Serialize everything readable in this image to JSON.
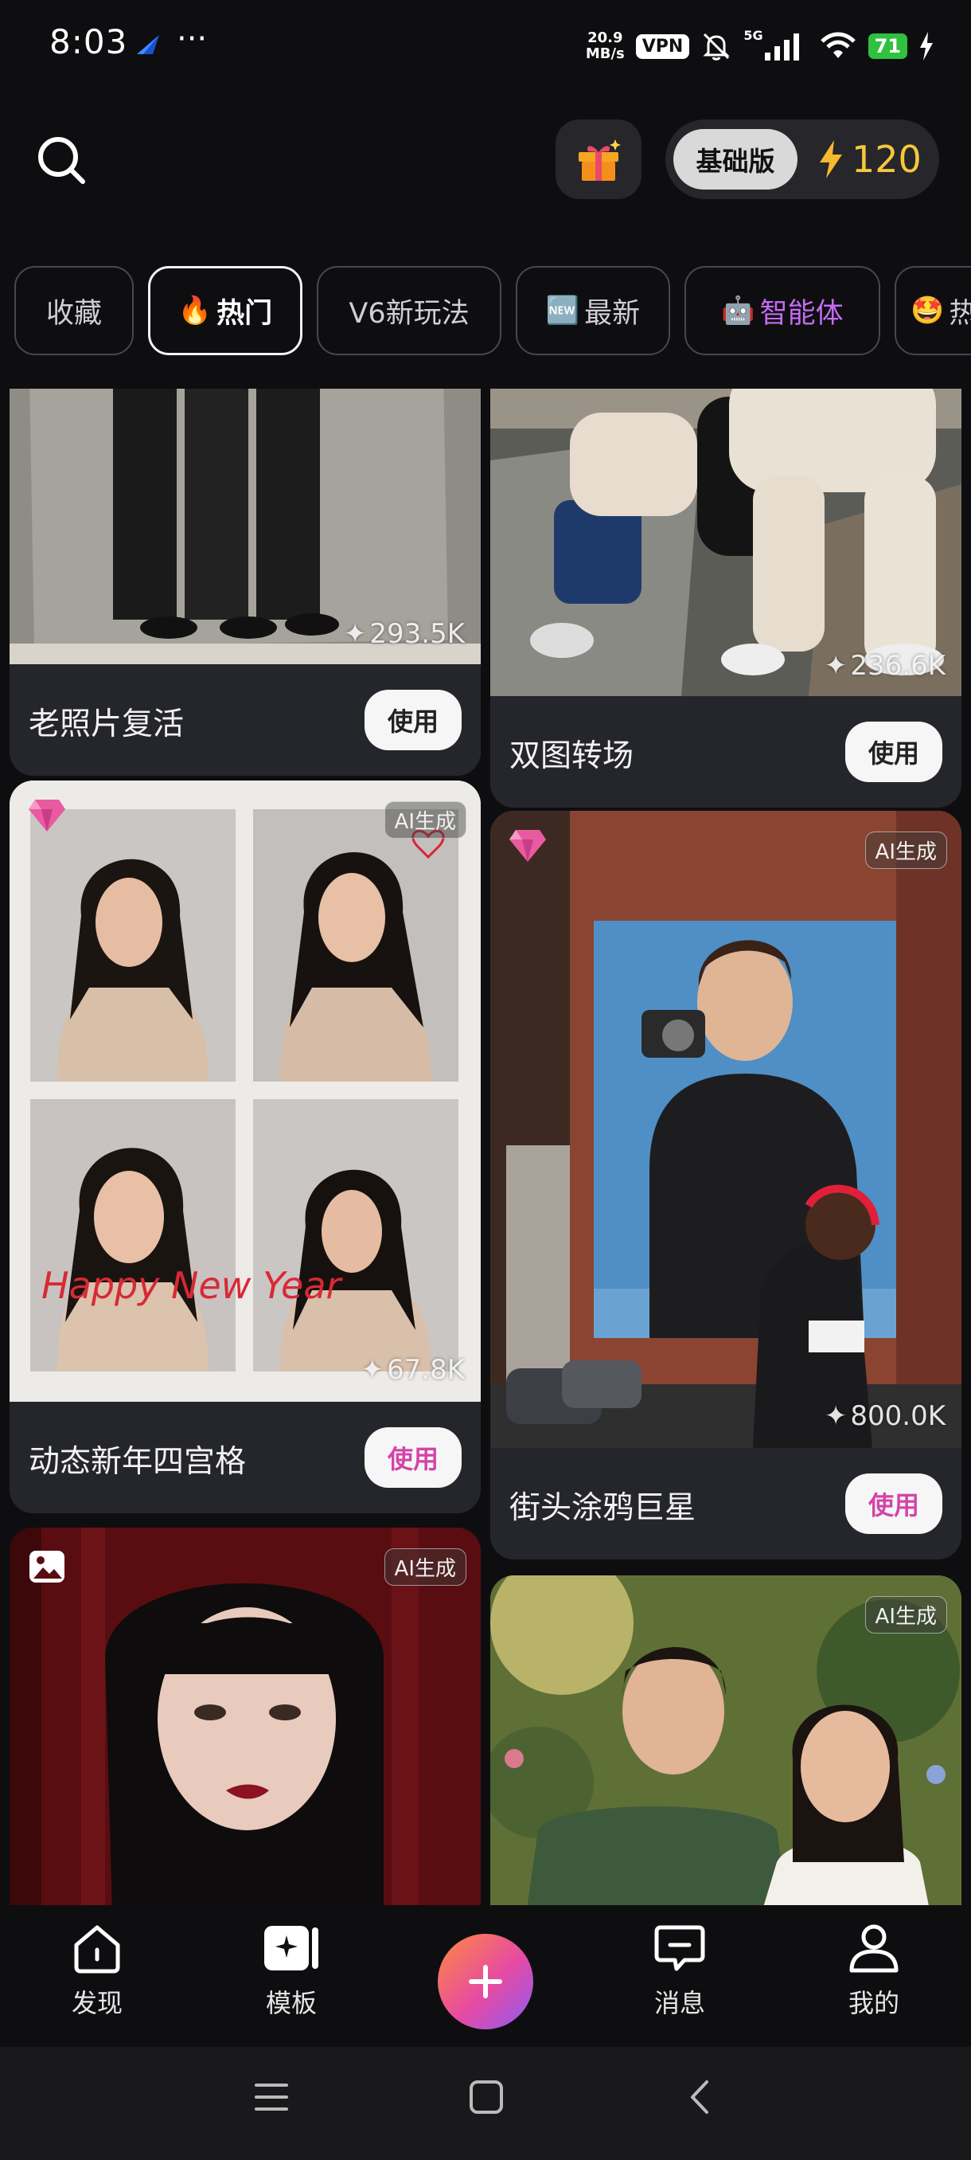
{
  "status_bar": {
    "time": "8:03",
    "dots": "···",
    "net_speed_value": "20.9",
    "net_speed_unit": "MB/s",
    "vpn": "VPN",
    "network": "5G",
    "battery": "71"
  },
  "header": {
    "plan_label": "基础版",
    "credits": "120"
  },
  "tabs": [
    {
      "label": "收藏",
      "emoji": ""
    },
    {
      "label": "热门",
      "emoji": "🔥"
    },
    {
      "label": "V6新玩法",
      "emoji": ""
    },
    {
      "label": "最新",
      "emoji": "🆕"
    },
    {
      "label": "智能体",
      "emoji": "🤖"
    },
    {
      "label": "热",
      "emoji": "🤩"
    }
  ],
  "cards": [
    {
      "title": "老照片复活",
      "views": "293.5K",
      "button": "使用"
    },
    {
      "title": "双图转场",
      "views": "236.6K",
      "button": "使用"
    },
    {
      "title": "动态新年四宫格",
      "views": "67.8K",
      "button": "使用",
      "badge": "AI生成",
      "overlay_text": "Happy New Year"
    },
    {
      "title": "街头涂鸦巨星",
      "views": "800.0K",
      "button": "使用",
      "badge": "AI生成"
    },
    {
      "title": "",
      "badge": "AI生成"
    },
    {
      "title": "",
      "badge": "AI生成"
    }
  ],
  "bottom_nav": [
    {
      "label": "发现",
      "icon": "home-icon"
    },
    {
      "label": "模板",
      "icon": "template-icon"
    },
    {
      "label": "",
      "icon": "plus-icon"
    },
    {
      "label": "消息",
      "icon": "message-icon"
    },
    {
      "label": "我的",
      "icon": "profile-icon"
    }
  ],
  "colors": {
    "background": "#0e0e11",
    "card": "#25262b",
    "credits": "#f5c83a",
    "agent_tab": "#c46bf2",
    "battery": "#2fc13f"
  }
}
